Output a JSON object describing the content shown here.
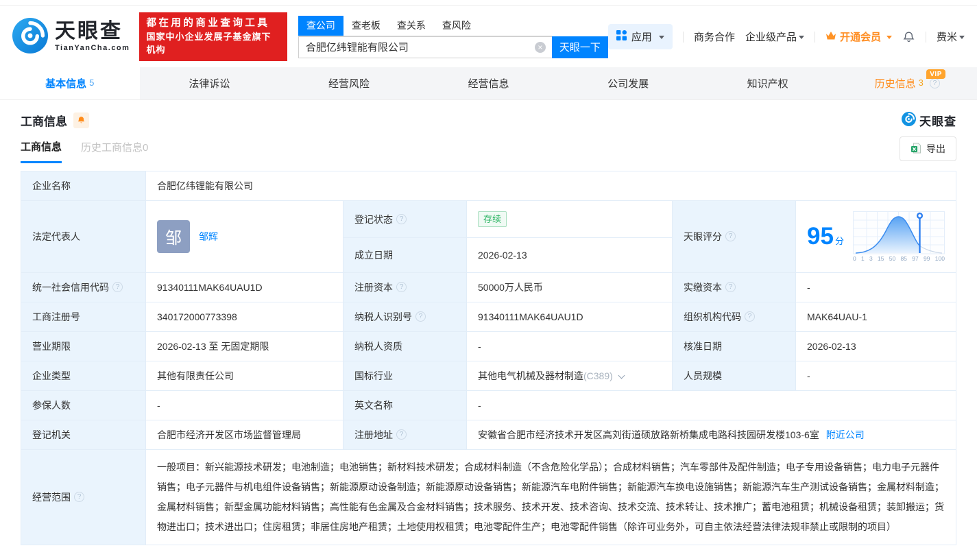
{
  "brand": {
    "name": "天眼查",
    "domain": "TianYanCha.com",
    "slogan_line1": "都在用的商业查询工具",
    "slogan_line2": "国家中小企业发展子基金旗下机构"
  },
  "search": {
    "tabs": [
      "查公司",
      "查老板",
      "查关系",
      "查风险"
    ],
    "active_tab": "查公司",
    "input_value": "合肥亿纬锂能有限公司",
    "button_label": "天眼一下"
  },
  "header_menu": {
    "apps": "应用",
    "cooperation": "商务合作",
    "enterprise_products": "企业级产品",
    "vip": "开通会员",
    "user": "费米"
  },
  "nav": {
    "tabs": [
      {
        "label": "基本信息",
        "count": "5"
      },
      {
        "label": "法律诉讼",
        "count": ""
      },
      {
        "label": "经营风险",
        "count": ""
      },
      {
        "label": "经营信息",
        "count": ""
      },
      {
        "label": "公司发展",
        "count": ""
      },
      {
        "label": "知识产权",
        "count": ""
      },
      {
        "label": "历史信息",
        "count": "3"
      }
    ],
    "vip_badge": "VIP"
  },
  "section": {
    "title": "工商信息",
    "watermark": "天眼查",
    "subtab_active": "工商信息",
    "subtab_history": "历史工商信息0",
    "export_label": "导出"
  },
  "icons": {
    "help": "?",
    "clear": "×",
    "avatar_char": "邹"
  },
  "colors": {
    "accent": "#0084ff",
    "brand_red": "#e02020",
    "vip_orange": "#ff8e23",
    "status_green": "#28b360"
  },
  "table": {
    "company_name": {
      "label": "企业名称",
      "value": "合肥亿纬锂能有限公司"
    },
    "legal_rep": {
      "label": "法定代表人",
      "name": "邹辉"
    },
    "reg_status": {
      "label": "登记状态",
      "value": "存续"
    },
    "establish_date": {
      "label": "成立日期",
      "value": "2026-02-13"
    },
    "tyc_score": {
      "label": "天眼评分",
      "score": "95",
      "unit": "分"
    },
    "credit_code": {
      "label": "统一社会信用代码",
      "value": "91340111MAK64UAU1D"
    },
    "reg_capital": {
      "label": "注册资本",
      "value": "50000万人民币"
    },
    "paid_capital": {
      "label": "实缴资本",
      "value": "-"
    },
    "reg_number": {
      "label": "工商注册号",
      "value": "340172000773398"
    },
    "taxpayer_id": {
      "label": "纳税人识别号",
      "value": "91340111MAK64UAU1D"
    },
    "org_code": {
      "label": "组织机构代码",
      "value": "MAK64UAU-1"
    },
    "business_term": {
      "label": "营业期限",
      "value": "2026-02-13 至 无固定期限"
    },
    "taxpayer_qualification": {
      "label": "纳税人资质",
      "value": "-"
    },
    "approval_date": {
      "label": "核准日期",
      "value": "2026-02-13"
    },
    "company_type": {
      "label": "企业类型",
      "value": "其他有限责任公司"
    },
    "industry": {
      "label": "国标行业",
      "value": "其他电气机械及器材制造",
      "code": "(C389)"
    },
    "staff_size": {
      "label": "人员规模",
      "value": "-"
    },
    "insured_count": {
      "label": "参保人数",
      "value": "-"
    },
    "english_name": {
      "label": "英文名称",
      "value": "-"
    },
    "reg_authority": {
      "label": "登记机关",
      "value": "合肥市经济开发区市场监督管理局"
    },
    "reg_address": {
      "label": "注册地址",
      "value": "安徽省合肥市经济技术开发区高刘街道硕放路新桥集成电路科技园研发楼103-6室",
      "nearby_link": "附近公司"
    },
    "business_scope": {
      "label": "经营范围",
      "value": "一般项目：新兴能源技术研发；电池制造；电池销售；新材料技术研发；合成材料制造（不含危险化学品）；合成材料销售；汽车零部件及配件制造；电子专用设备销售；电力电子元器件销售；电子元器件与机电组件设备销售；新能源原动设备制造；新能源原动设备销售；新能源汽车电附件销售；新能源汽车换电设施销售；新能源汽车生产测试设备销售；金属材料制造；金属材料销售；新型金属功能材料销售；高性能有色金属及合金材料销售；技术服务、技术开发、技术咨询、技术交流、技术转让、技术推广；蓄电池租赁；机械设备租赁；装卸搬运；货物进出口；技术进出口；住房租赁；非居住房地产租赁；土地使用权租赁；电池零配件生产；电池零配件销售（除许可业务外，可自主依法经营法律法规非禁止或限制的项目）"
    }
  },
  "score_chart": {
    "type": "area",
    "description": "天眼评分分布钟形曲线",
    "score": 95,
    "marker_value": 97,
    "ticks": [
      "0",
      "1",
      "3",
      "15",
      "50",
      "85",
      "97",
      "99",
      "100"
    ],
    "accent": "#0084ff"
  }
}
